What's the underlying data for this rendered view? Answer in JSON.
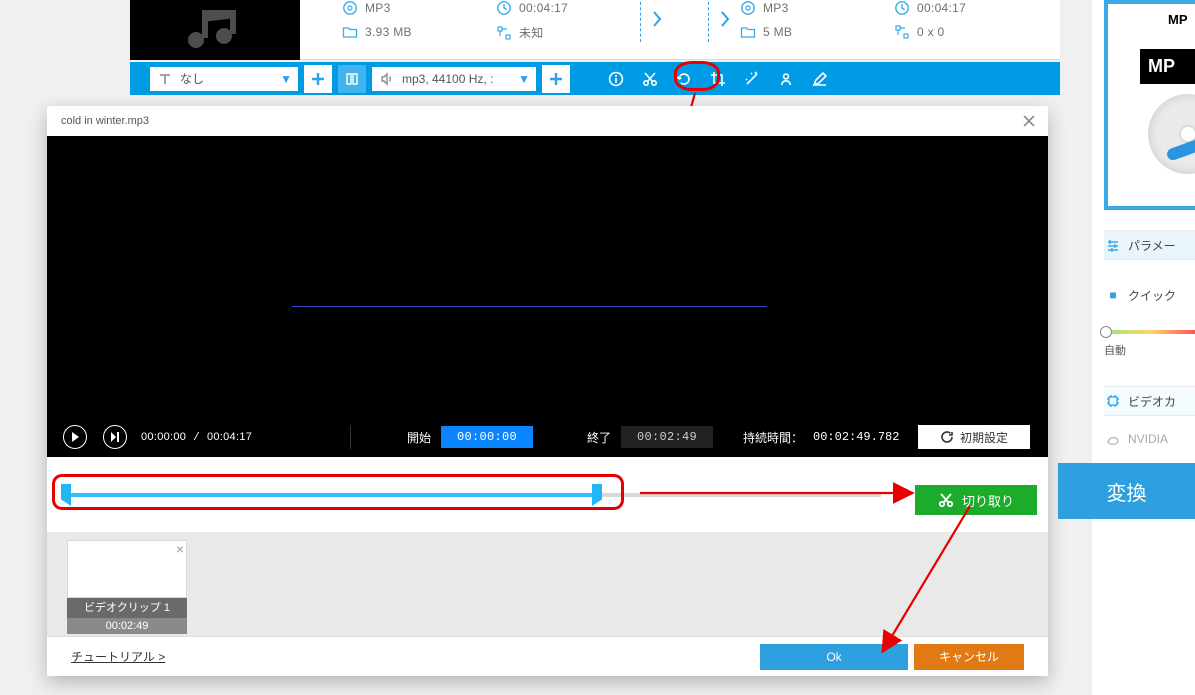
{
  "file_row": {
    "left": {
      "format": "MP3",
      "duration": "00:04:17",
      "size": "3.93 MB",
      "dimensions": "未知"
    },
    "right": {
      "format": "MP3",
      "duration": "00:04:17",
      "size": "5 MB",
      "dimensions": "0 x 0"
    }
  },
  "toolbar": {
    "subtitle_label": "なし",
    "audio_label": "mp3, 44100 Hz, :"
  },
  "modal": {
    "title": "cold in winter.mp3",
    "time_current": "00:00:00",
    "time_total": "00:04:17",
    "start_label": "開始",
    "end_label": "終了",
    "duration_label": "持続時間：",
    "start_value": "00:00:00",
    "end_value": "00:02:49",
    "duration_value": "00:02:49.782",
    "reset_label": "初期設定",
    "cut_label": "切り取り",
    "clip_caption": "ビデオクリップ 1",
    "clip_subcaption": "00:02:49",
    "tutorial_label": "チュートリアル >",
    "ok_label": "Ok",
    "cancel_label": "キャンセル"
  },
  "right_panel": {
    "format_title": "MP",
    "format_badge": "MP",
    "parameter_label": "パラメー",
    "quick_label": "クイック",
    "slider_label": "自動",
    "video_card_label": "ビデオカ",
    "nvidia_label": "NVIDIA"
  },
  "convert_label": "変換"
}
